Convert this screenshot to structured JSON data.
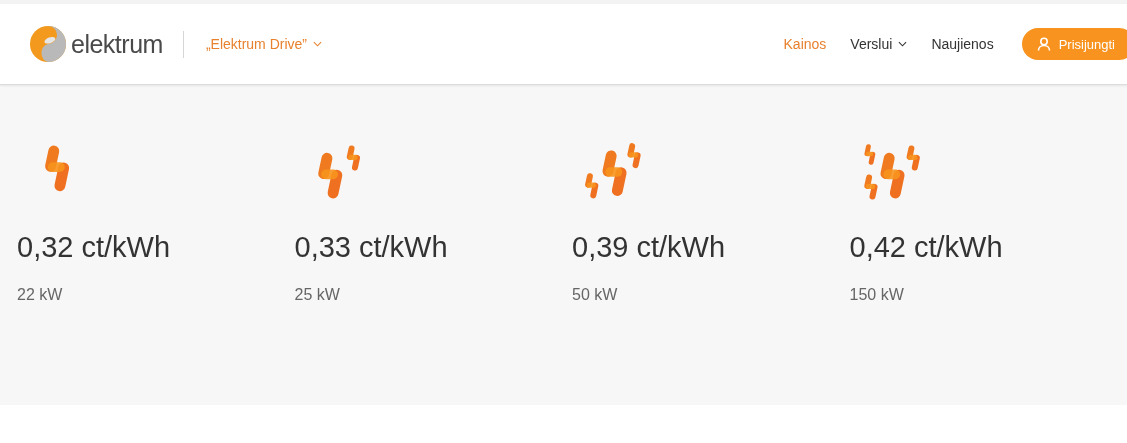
{
  "header": {
    "logo": {
      "text": "elektrum"
    },
    "product": {
      "label": "„Elektrum Drive”"
    },
    "nav": [
      {
        "label": "Kainos",
        "selected": true,
        "dropdown": false
      },
      {
        "label": "Verslui",
        "selected": false,
        "dropdown": true
      },
      {
        "label": "Naujienos",
        "selected": false,
        "dropdown": false
      }
    ],
    "login_button": {
      "label": "Prisijungti"
    }
  },
  "tariffs": [
    {
      "kind": "single",
      "price": "0,32 ct/kWh",
      "power": "22 kW"
    },
    {
      "kind": "double",
      "price": "0,33 ct/kWh",
      "power": "25 kW"
    },
    {
      "kind": "triple",
      "price": "0,39 ct/kWh",
      "power": "50 kW"
    },
    {
      "kind": "quad",
      "price": "0,42 ct/kWh",
      "power": "150 kW"
    }
  ]
}
